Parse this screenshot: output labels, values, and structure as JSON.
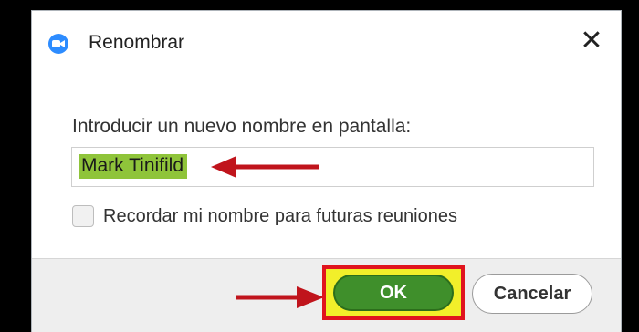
{
  "dialog": {
    "title": "Renombrar",
    "app_icon": "zoom-camera-icon",
    "close_glyph": "✕"
  },
  "form": {
    "prompt": "Introducir un nuevo nombre en pantalla:",
    "name_value": "Mark Tinifild",
    "remember_label": "Recordar mi nombre para futuras reuniones",
    "remember_checked": false
  },
  "buttons": {
    "ok_label": "OK",
    "cancel_label": "Cancelar"
  },
  "annotations": {
    "arrow_color": "#c0141c",
    "highlight_border": "#e0141e",
    "highlight_fill": "#f2ef2a",
    "name_highlight": "#8fc43a"
  }
}
